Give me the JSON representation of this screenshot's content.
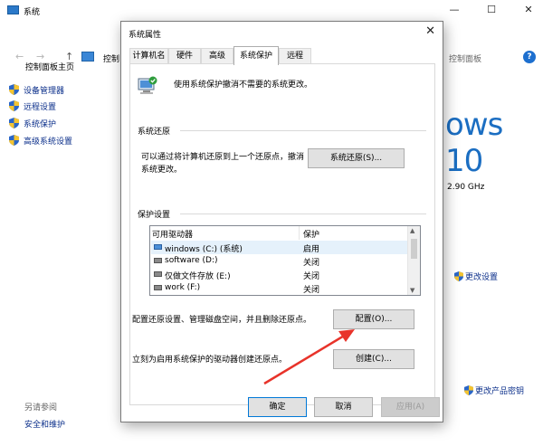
{
  "background_window": {
    "title": "系统",
    "address_text": "控制",
    "search_text": "控制面板",
    "left_panel": {
      "home": "控制面板主页",
      "links": [
        "设备管理器",
        "远程设置",
        "系统保护",
        "高级系统设置"
      ],
      "see_also": "另请参阅",
      "security": "安全和维护"
    },
    "brand_text": "ows 10",
    "cpu_speed": "2.90 GHz",
    "change_settings": "更改设置",
    "change_product_key": "更改产品密钥",
    "window_controls": {
      "minimize": "—",
      "maximize": "☐",
      "close": "✕"
    },
    "nav": {
      "back": "←",
      "forward": "→",
      "up": "↑",
      "help": "?"
    }
  },
  "dialog": {
    "title": "系统属性",
    "close_glyph": "✕",
    "tabs": [
      "计算机名",
      "硬件",
      "高级",
      "系统保护",
      "远程"
    ],
    "active_tab": "系统保护",
    "intro_text": "使用系统保护撤消不需要的系统更改。",
    "restore_group": {
      "title": "系统还原",
      "description": "可以通过将计算机还原到上一个还原点，撤消系统更改。",
      "button": "系统还原(S)..."
    },
    "protection_group": {
      "title": "保护设置",
      "columns": [
        "可用驱动器",
        "保护"
      ],
      "drives": [
        {
          "name": "windows (C:) (系统)",
          "status": "启用",
          "system": true
        },
        {
          "name": "software (D:)",
          "status": "关闭",
          "system": false
        },
        {
          "name": "仅做文件存放 (E:)",
          "status": "关闭",
          "system": false
        },
        {
          "name": "work (F:)",
          "status": "关闭",
          "system": false
        }
      ],
      "config_desc": "配置还原设置、管理磁盘空间，并且删除还原点。",
      "config_button": "配置(O)...",
      "create_desc": "立刻为启用系统保护的驱动器创建还原点。",
      "create_button": "创建(C)..."
    },
    "ok": "确定",
    "cancel": "取消",
    "apply": "应用(A)"
  },
  "colors": {
    "link": "#0a2e8a",
    "accent": "#1b6ec2",
    "annotation_arrow": "#e8332a"
  }
}
